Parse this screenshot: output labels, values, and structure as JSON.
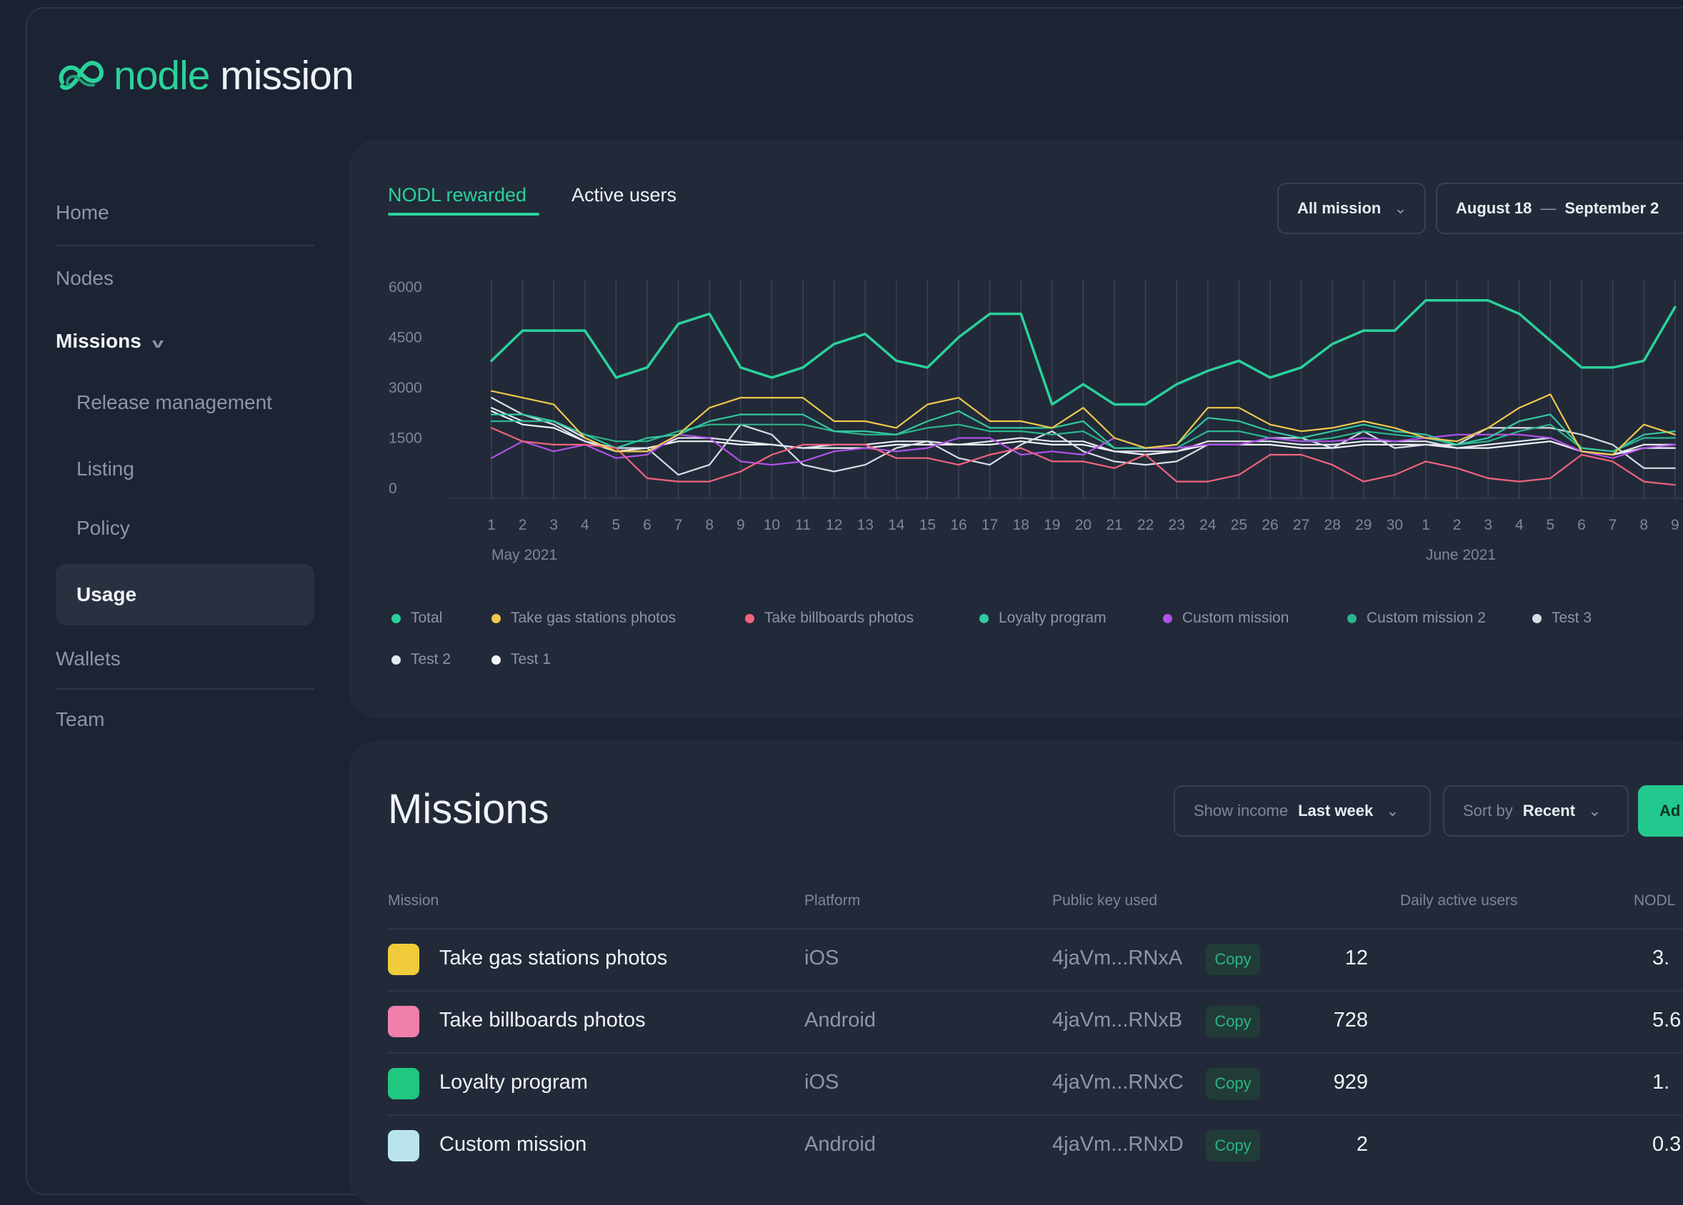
{
  "brand": {
    "name_part1": "nodle",
    "name_part2": " mission",
    "logo_icon": "nodle-infinity-icon"
  },
  "sidebar": {
    "items": [
      {
        "label": "Home"
      },
      {
        "label": "Nodes"
      },
      {
        "label": "Missions",
        "expanded": true
      },
      {
        "label": "Release management"
      },
      {
        "label": "Listing"
      },
      {
        "label": "Policy"
      },
      {
        "label": "Usage",
        "active": true
      },
      {
        "label": "Wallets"
      },
      {
        "label": "Team"
      }
    ]
  },
  "chart_panel": {
    "tabs": [
      {
        "label": "NODL rewarded",
        "active": true
      },
      {
        "label": "Active users"
      }
    ],
    "mission_filter": "All mission",
    "date_range": {
      "start": "August 18",
      "separator": "—",
      "end": "September 2"
    }
  },
  "chart_data": {
    "type": "line",
    "ylim": [
      0,
      6000
    ],
    "yticks": [
      "6000",
      "4500",
      "3000",
      "1500",
      "0"
    ],
    "x": [
      "1",
      "2",
      "3",
      "4",
      "5",
      "6",
      "7",
      "8",
      "9",
      "10",
      "11",
      "12",
      "13",
      "14",
      "15",
      "16",
      "17",
      "18",
      "19",
      "20",
      "21",
      "22",
      "23",
      "24",
      "25",
      "26",
      "27",
      "28",
      "29",
      "30",
      "1",
      "2",
      "3",
      "4",
      "5",
      "6",
      "7",
      "8",
      "9"
    ],
    "month_labels": [
      {
        "label": "May 2021",
        "index": 0
      },
      {
        "label": "June 2021",
        "index": 30
      }
    ],
    "series": [
      {
        "name": "Total",
        "color": "#2ad29a",
        "values": [
          3800,
          4700,
          4700,
          4700,
          3300,
          3600,
          4900,
          5200,
          3600,
          3300,
          3600,
          4300,
          4600,
          3800,
          3600,
          4500,
          5200,
          5200,
          2500,
          3100,
          2500,
          2500,
          3100,
          3500,
          3800,
          3300,
          3600,
          4300,
          4700,
          4700,
          5600,
          5600,
          5600,
          5200,
          4400,
          3600,
          3600,
          3800,
          5400
        ]
      },
      {
        "name": "Take gas stations photos",
        "color": "#f0c84a",
        "values": [
          2900,
          2700,
          2500,
          1500,
          1100,
          1100,
          1600,
          2400,
          2700,
          2700,
          2700,
          2000,
          2000,
          1800,
          2500,
          2700,
          2000,
          2000,
          1800,
          2400,
          1500,
          1200,
          1300,
          2400,
          2400,
          1900,
          1700,
          1800,
          2000,
          1800,
          1500,
          1400,
          1800,
          2400,
          2800,
          1100,
          1000,
          1900,
          1600
        ]
      },
      {
        "name": "Take billboards photos",
        "color": "#f2637f",
        "values": [
          1800,
          1400,
          1300,
          1300,
          1200,
          300,
          200,
          200,
          500,
          1000,
          1300,
          1300,
          1300,
          900,
          900,
          700,
          1000,
          1200,
          800,
          800,
          600,
          1000,
          200,
          200,
          400,
          1000,
          1000,
          700,
          200,
          400,
          800,
          600,
          300,
          200,
          300,
          1000,
          800,
          200,
          100
        ]
      },
      {
        "name": "Loyalty program",
        "color": "#32c8a0",
        "values": [
          2200,
          2200,
          2000,
          1600,
          1200,
          1500,
          1600,
          2000,
          2200,
          2200,
          2200,
          1700,
          1700,
          1600,
          2000,
          2300,
          1800,
          1800,
          1800,
          2000,
          1200,
          1200,
          1300,
          2100,
          2000,
          1700,
          1500,
          1700,
          1900,
          1700,
          1600,
          1300,
          1500,
          2000,
          2200,
          1200,
          1100,
          1600,
          1700
        ]
      },
      {
        "name": "Custom mission",
        "color": "#b052e8",
        "values": [
          900,
          1400,
          1100,
          1300,
          900,
          1000,
          1600,
          1500,
          800,
          700,
          800,
          1100,
          1200,
          1100,
          1200,
          1500,
          1500,
          1000,
          1100,
          1000,
          1500,
          1200,
          1200,
          1300,
          1300,
          1500,
          1400,
          1400,
          1500,
          1400,
          1500,
          1600,
          1600,
          1600,
          1500,
          1100,
          900,
          1200,
          1300
        ]
      },
      {
        "name": "Custom mission 2",
        "color": "#2bb58c",
        "values": [
          2000,
          2000,
          2000,
          1600,
          1400,
          1400,
          1700,
          1900,
          1900,
          1900,
          1900,
          1700,
          1600,
          1600,
          1800,
          1900,
          1700,
          1700,
          1600,
          1700,
          1200,
          1200,
          1200,
          1700,
          1700,
          1500,
          1400,
          1500,
          1700,
          1600,
          1500,
          1300,
          1400,
          1700,
          1900,
          1200,
          1100,
          1500,
          1500
        ]
      },
      {
        "name": "Test 3",
        "color": "#d8dde6",
        "values": [
          2700,
          2200,
          1900,
          1400,
          1200,
          1200,
          400,
          700,
          1900,
          1600,
          700,
          500,
          700,
          1200,
          1400,
          900,
          700,
          1300,
          1700,
          1100,
          800,
          700,
          800,
          1300,
          1300,
          1500,
          1500,
          1200,
          1700,
          1200,
          1300,
          1300,
          1800,
          1800,
          1800,
          1600,
          1300,
          600,
          600
        ]
      },
      {
        "name": "Test 2",
        "color": "#e4e8ef",
        "values": [
          2400,
          2000,
          2000,
          1500,
          1100,
          1100,
          1500,
          1500,
          1400,
          1300,
          1200,
          1300,
          1300,
          1400,
          1400,
          1300,
          1400,
          1500,
          1400,
          1400,
          1100,
          1100,
          1100,
          1400,
          1400,
          1400,
          1300,
          1300,
          1400,
          1400,
          1400,
          1200,
          1300,
          1400,
          1500,
          1100,
          1000,
          1300,
          1300
        ]
      },
      {
        "name": "Test 1",
        "color": "#f2f4f7",
        "values": [
          2300,
          1900,
          1800,
          1400,
          1100,
          1200,
          1400,
          1400,
          1300,
          1300,
          1200,
          1200,
          1200,
          1300,
          1300,
          1300,
          1300,
          1400,
          1300,
          1300,
          1100,
          1000,
          1100,
          1300,
          1300,
          1300,
          1200,
          1200,
          1300,
          1300,
          1300,
          1200,
          1200,
          1300,
          1400,
          1100,
          1000,
          1200,
          1200
        ]
      }
    ],
    "legend_rows": [
      [
        "Total",
        "Take gas stations photos",
        "Take billboards photos",
        "Loyalty program",
        "Custom mission",
        "Custom mission 2",
        "Test 3"
      ],
      [
        "Test 2",
        "Test 1"
      ]
    ],
    "grid": "vertical"
  },
  "missions": {
    "title": "Missions",
    "show_income": {
      "label": "Show income",
      "value": "Last week"
    },
    "sort_by": {
      "label": "Sort by",
      "value": "Recent"
    },
    "add_button_label": "Ad",
    "columns": [
      "Mission",
      "Platform",
      "Public key used",
      "Daily active users",
      "NODL"
    ],
    "copy_label": "Copy",
    "rows": [
      {
        "name": "Take gas stations photos",
        "platform": "iOS",
        "public_key": "4jaVm...RNxA",
        "dau": "12",
        "nodl": "3.",
        "icon_color": "#f0cc3a"
      },
      {
        "name": "Take billboards photos",
        "platform": "Android",
        "public_key": "4jaVm...RNxB",
        "dau": "728",
        "nodl": "5.6",
        "icon_color": "#f07fab"
      },
      {
        "name": "Loyalty program",
        "platform": "iOS",
        "public_key": "4jaVm...RNxC",
        "dau": "929",
        "nodl": "1.",
        "icon_color": "#20c77e"
      },
      {
        "name": "Custom mission",
        "platform": "Android",
        "public_key": "4jaVm...RNxD",
        "dau": "2",
        "nodl": "0.3",
        "icon_color": "#b9e4ee"
      }
    ]
  }
}
